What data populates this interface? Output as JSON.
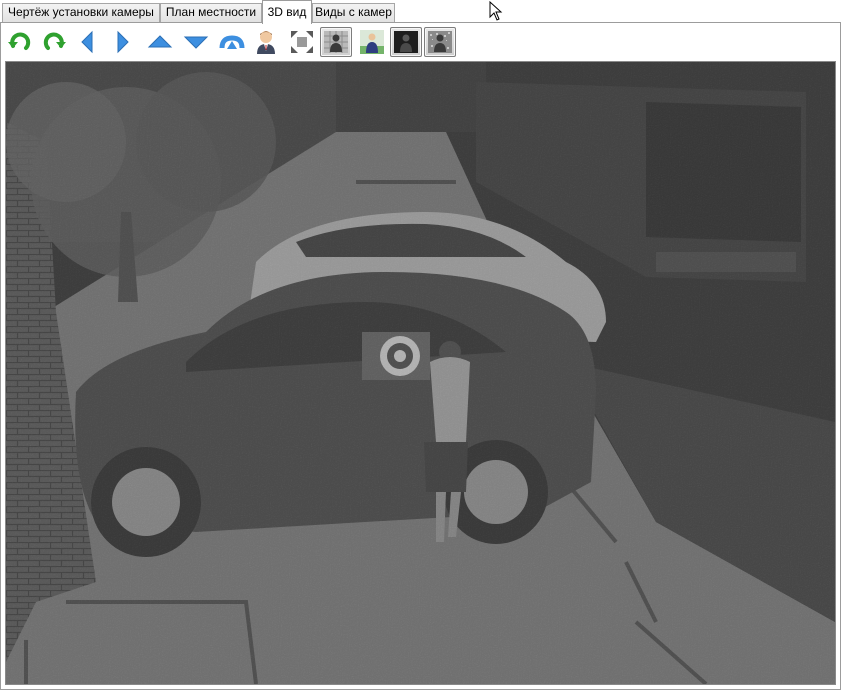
{
  "tabs": [
    {
      "label": "Чертёж установки камеры",
      "active": false
    },
    {
      "label": "План местности",
      "active": false
    },
    {
      "label": "3D вид",
      "active": true
    },
    {
      "label": "Виды с камер",
      "active": false
    }
  ],
  "toolbar": {
    "buttons": [
      {
        "icon": "rotate-left-icon",
        "color": "#2fa12f"
      },
      {
        "icon": "rotate-right-icon",
        "color": "#2fa12f"
      },
      {
        "icon": "arrow-left-icon",
        "color": "#3d8fe0"
      },
      {
        "icon": "arrow-right-icon",
        "color": "#3d8fe0"
      },
      {
        "icon": "arrow-up-icon",
        "color": "#3d8fe0"
      },
      {
        "icon": "arrow-down-icon",
        "color": "#3d8fe0"
      },
      {
        "icon": "arrow-back-up-icon",
        "color": "#3d8fe0"
      },
      {
        "icon": "person-icon",
        "color": "#c07838"
      },
      {
        "icon": "fit-view-icon",
        "color": "#6a6a6a"
      },
      {
        "icon": "person-grid-view-icon",
        "color": "#9a9a9a",
        "pressed": true
      },
      {
        "icon": "person-color-view-icon",
        "color": "#74b46a"
      },
      {
        "icon": "person-night-view-icon",
        "color": "#2a2a2a",
        "pressed": true
      },
      {
        "icon": "person-noise-view-icon",
        "color": "#8a8a8a",
        "pressed": true
      }
    ]
  },
  "viewport": {
    "scene": "3d-parking-lot-night-view",
    "background_color": "#1f1f1f",
    "ground_color": "#6e6e6e"
  }
}
